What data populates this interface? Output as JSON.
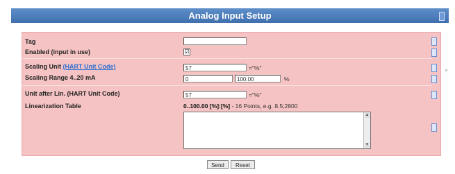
{
  "title": "Analog Input Setup",
  "colors": {
    "title_bar": "#4a7bbd",
    "panel": "#f5c3c3",
    "link": "#2d6fd1"
  },
  "fields": {
    "tag": {
      "label": "Tag",
      "value": ""
    },
    "enabled": {
      "label": "Enabled (input in use)",
      "checked": true,
      "mark": "☑"
    },
    "scaling_unit": {
      "label": "Scaling Unit",
      "link": "(HART Unit Code)",
      "value": "57",
      "unit": "=\"%\""
    },
    "scaling_range": {
      "label": "Scaling Range 4..20 mA",
      "from": "0",
      "to": "100.00",
      "unit": "%"
    },
    "unit_after_lin": {
      "label": "Unit after Lin. (HART Unit Code)",
      "value": "57",
      "unit": "=\"%\""
    },
    "lin_table": {
      "label": "Linearization Table",
      "format": "0..100.00 [%]:[%]",
      "hint": " - 16 Points, e.g. 8.5;2800",
      "value": ""
    }
  },
  "buttons": {
    "send": "Send",
    "reset": "Reset"
  },
  "icons": {
    "help": "help-icon"
  }
}
